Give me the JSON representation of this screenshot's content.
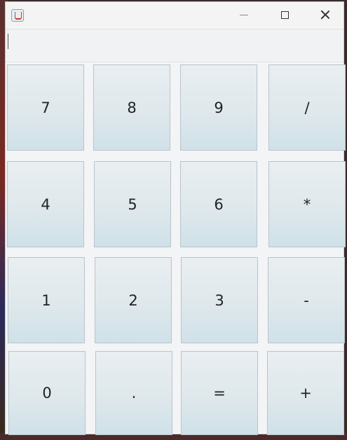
{
  "window": {
    "icon": "java-cup-icon",
    "controls": [
      "minimize-icon",
      "maximize-icon",
      "close-icon"
    ]
  },
  "display": {
    "value": ""
  },
  "keys": [
    [
      "7",
      "8",
      "9",
      "/"
    ],
    [
      "4",
      "5",
      "6",
      "*"
    ],
    [
      "1",
      "2",
      "3",
      "-"
    ],
    [
      "0",
      ".",
      "=",
      "+"
    ]
  ]
}
